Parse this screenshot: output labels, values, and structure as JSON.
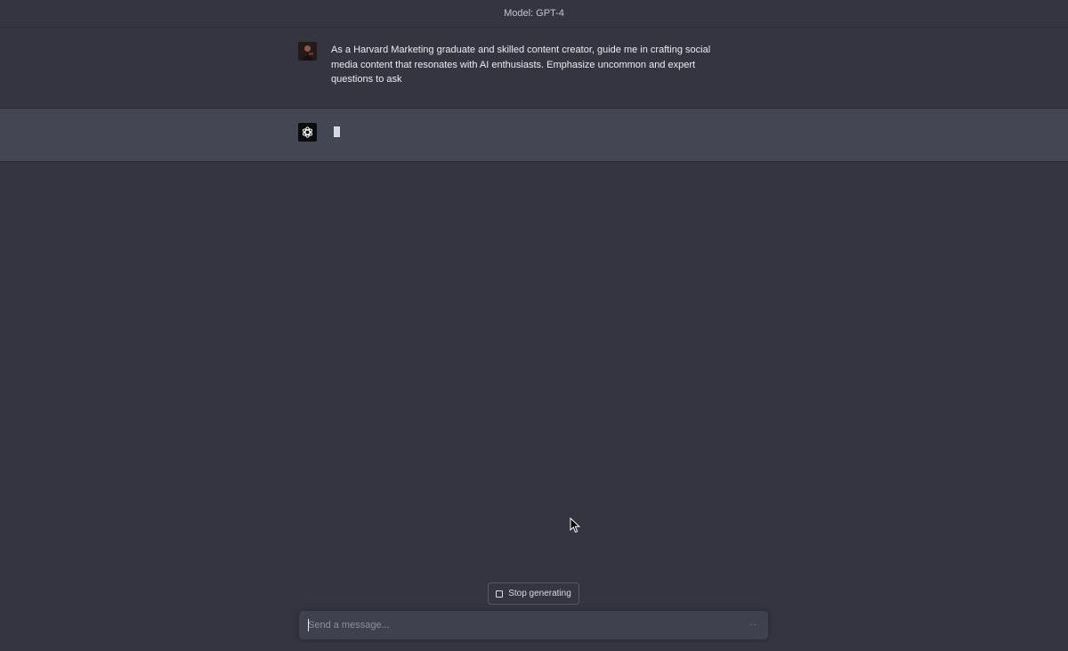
{
  "header": {
    "model_label": "Model: GPT-4"
  },
  "conversation": {
    "user_message": "As a Harvard Marketing graduate and skilled content creator, guide me in crafting social media content that resonates with AI enthusiasts. Emphasize uncommon and expert questions to ask",
    "assistant_message": ""
  },
  "controls": {
    "stop_label": "Stop generating",
    "input_placeholder": "Send a message...",
    "send_icon": "··"
  },
  "icons": {
    "user_avatar": "user-avatar-photo",
    "assistant_avatar": "openai-logo-icon",
    "stop_icon": "stop-square-icon",
    "send_icon": "send-dots-icon",
    "mouse_cursor": "mouse-pointer-icon"
  },
  "colors": {
    "background": "#343541",
    "assistant_row": "#444654",
    "input_bg": "#40414f",
    "text": "#ececf1"
  }
}
